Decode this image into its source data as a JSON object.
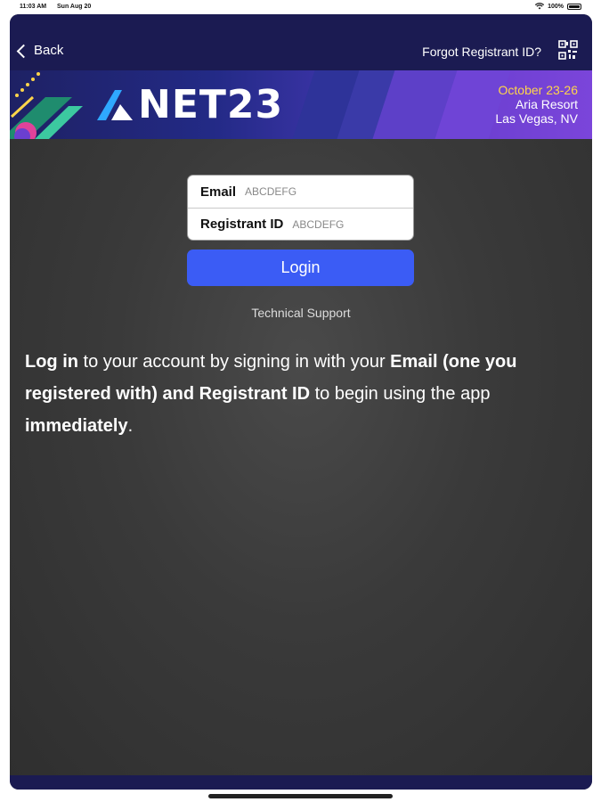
{
  "status_bar": {
    "time": "11:03 AM",
    "date": "Sun Aug 20",
    "battery": "100%"
  },
  "nav": {
    "back_label": "Back",
    "forgot_label": "Forgot Registrant ID?"
  },
  "banner": {
    "logo_text": "NET23",
    "event_dates": "October 23-26",
    "venue": "Aria Resort",
    "city": "Las Vegas, NV"
  },
  "login": {
    "email_label": "Email",
    "email_placeholder": "ABCDEFG",
    "registrant_label": "Registrant ID",
    "registrant_placeholder": "ABCDEFG",
    "login_button": "Login",
    "support_link": "Technical Support"
  },
  "intro": {
    "part1": "Log in",
    "part2": " to your account by signing in with your ",
    "part3": "Email (one you registered with) and Registrant ID",
    "part4": " to begin using the app ",
    "part5": "immediately",
    "part6": "."
  },
  "colors": {
    "nav_bg": "#1b1b52",
    "login_button": "#3b5cf5",
    "accent_date": "#ffd54a"
  }
}
